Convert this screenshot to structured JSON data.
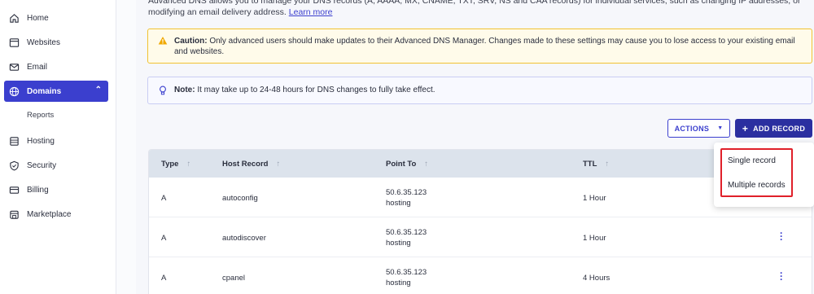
{
  "sidebar": {
    "items": [
      {
        "label": "Home",
        "icon": "home-icon"
      },
      {
        "label": "Websites",
        "icon": "websites-icon"
      },
      {
        "label": "Email",
        "icon": "email-icon"
      },
      {
        "label": "Domains",
        "icon": "globe-icon",
        "active": true
      },
      {
        "label": "Hosting",
        "icon": "server-icon"
      },
      {
        "label": "Security",
        "icon": "shield-icon"
      },
      {
        "label": "Billing",
        "icon": "card-icon"
      },
      {
        "label": "Marketplace",
        "icon": "store-icon"
      }
    ],
    "sub_items": [
      {
        "label": "Reports"
      }
    ]
  },
  "intro": {
    "text": "Advanced DNS allows you to manage your DNS records (A, AAAA, MX, CNAME, TXT, SRV, NS and CAA records) for individual services, such as changing IP addresses, or modifying an email delivery address.",
    "link": "Learn more"
  },
  "caution": {
    "title": "Caution:",
    "text": "Only advanced users should make updates to their Advanced DNS Manager. Changes made to these settings may cause you to lose access to your existing email and websites."
  },
  "note": {
    "title": "Note:",
    "text": "It may take up to 24-48 hours for DNS changes to fully take effect."
  },
  "toolbar": {
    "actions_label": "ACTIONS",
    "add_label": "ADD RECORD"
  },
  "table": {
    "columns": [
      "Type",
      "Host Record",
      "Point To",
      "TTL"
    ],
    "rows": [
      {
        "type": "A",
        "host": "autoconfig",
        "point_ip": "50.6.35.123",
        "point_label": "hosting",
        "ttl": "1 Hour"
      },
      {
        "type": "A",
        "host": "autodiscover",
        "point_ip": "50.6.35.123",
        "point_label": "hosting",
        "ttl": "1 Hour"
      },
      {
        "type": "A",
        "host": "cpanel",
        "point_ip": "50.6.35.123",
        "point_label": "hosting",
        "ttl": "4 Hours"
      }
    ]
  },
  "dropdown": {
    "items": [
      "Single record",
      "Multiple records"
    ]
  },
  "colors": {
    "accent": "#3b3fce",
    "caution_border": "#f1c232",
    "highlight": "#e0202a"
  }
}
